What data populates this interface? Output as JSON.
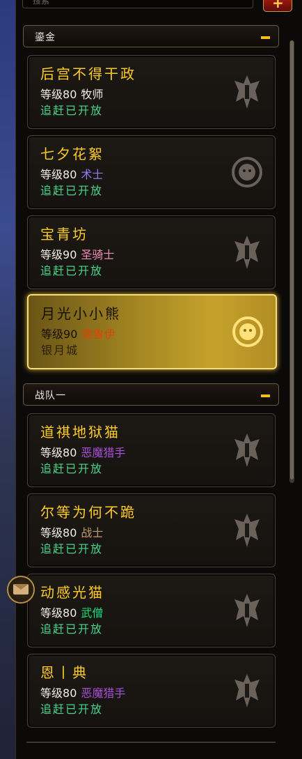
{
  "search": {
    "placeholder": "搜索"
  },
  "add_button": {
    "label": "+"
  },
  "groups": [
    {
      "title": "鎏金",
      "collapse": "−",
      "characters": [
        {
          "name": "后宫不得干政",
          "level_prefix": "等级",
          "level": "80",
          "class": "牧师",
          "class_color": "#f4f0e6",
          "status": "追赶已开放",
          "faction": "horde"
        },
        {
          "name": "七夕花絮",
          "level_prefix": "等级",
          "level": "80",
          "class": "术士",
          "class_color": "#8d7df4",
          "status": "追赶已开放",
          "faction": "alliance"
        },
        {
          "name": "宝青坊",
          "level_prefix": "等级",
          "level": "90",
          "class": "圣骑士",
          "class_color": "#f08cb8",
          "status": "追赶已开放",
          "faction": "horde"
        },
        {
          "name": "月光小小熊",
          "level_prefix": "等级",
          "level": "90",
          "class": "德鲁伊",
          "class_color": "#d8460a",
          "status": "银月城",
          "faction": "alliance",
          "selected": true
        }
      ]
    },
    {
      "title": "战队一",
      "collapse": "−",
      "characters": [
        {
          "name": "道祺地狱猫",
          "level_prefix": "等级",
          "level": "80",
          "class": "恶魔猎手",
          "class_color": "#a650d6",
          "status": "追赶已开放",
          "faction": "horde"
        },
        {
          "name": "尔等为何不跪",
          "level_prefix": "等级",
          "level": "80",
          "class": "战士",
          "class_color": "#c49a6c",
          "status": "追赶已开放",
          "faction": "horde"
        },
        {
          "name": "动感光猫",
          "level_prefix": "等级",
          "level": "80",
          "class": "武僧",
          "class_color": "#18e07a",
          "status": "追赶已开放",
          "faction": "horde"
        },
        {
          "name": "恩丨典",
          "level_prefix": "等级",
          "level": "80",
          "class": "恶魔猎手",
          "class_color": "#a650d6",
          "status": "追赶已开放",
          "faction": "horde"
        }
      ]
    }
  ]
}
